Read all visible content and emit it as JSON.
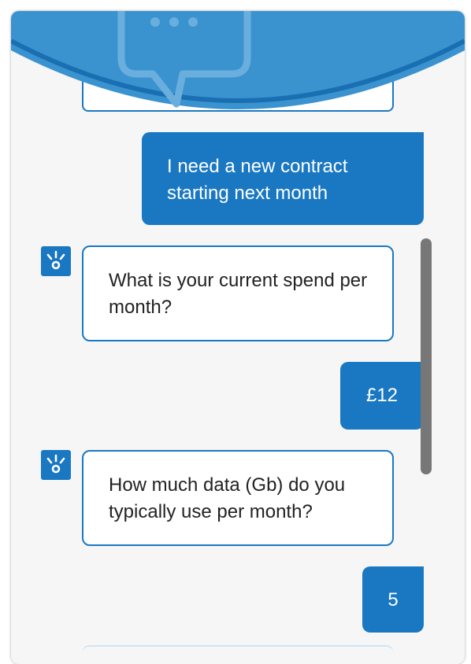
{
  "colors": {
    "accent": "#1a78c2",
    "background": "#f6f6f6",
    "bubble_text": "#ffffff",
    "scrollbar": "#777777"
  },
  "header": {
    "icon": "chat-bubble-icon"
  },
  "messages": [
    {
      "sender": "user",
      "text": "I need a new contract starting next month"
    },
    {
      "sender": "bot",
      "icon": "bot-logo-icon",
      "text": "What is your current spend per month?"
    },
    {
      "sender": "user",
      "text": "£12"
    },
    {
      "sender": "bot",
      "icon": "bot-logo-icon",
      "text": "How much data (Gb) do you typically use per month?"
    },
    {
      "sender": "user",
      "text": "5"
    }
  ]
}
